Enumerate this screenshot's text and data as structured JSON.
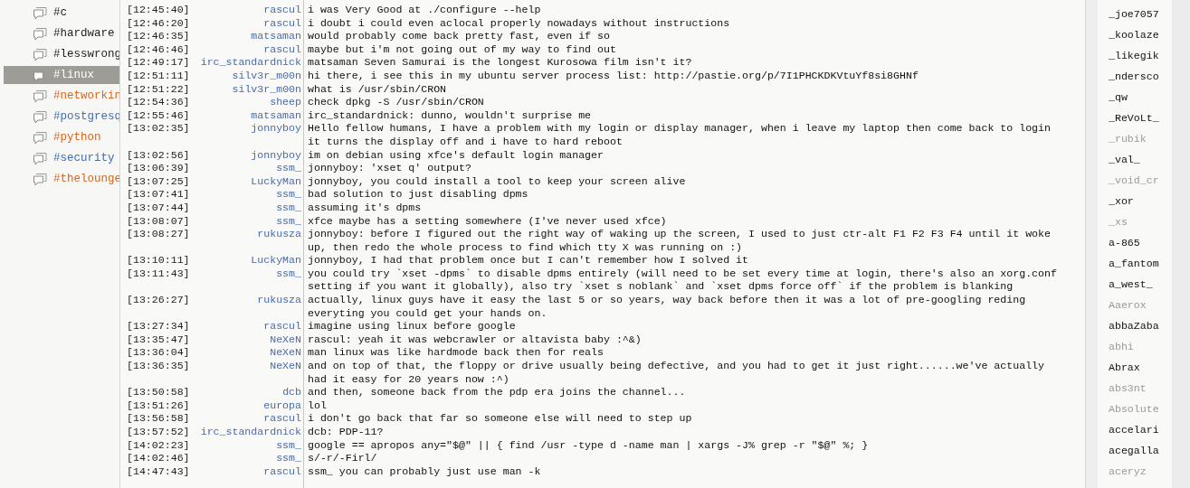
{
  "channels": [
    {
      "name": "#c",
      "selected": false
    },
    {
      "name": "#hardware",
      "selected": false
    },
    {
      "name": "#lesswrong",
      "selected": false
    },
    {
      "name": "#linux",
      "selected": true
    },
    {
      "name": "#networkin",
      "selected": false,
      "color": "#d9651c"
    },
    {
      "name": "#postgresq",
      "selected": false,
      "color": "#3d6cb8"
    },
    {
      "name": "#python",
      "selected": false,
      "color": "#d9651c"
    },
    {
      "name": "#security",
      "selected": false,
      "color": "#3d6cb8"
    },
    {
      "name": "#thelounge",
      "selected": false,
      "color": "#d9651c"
    }
  ],
  "messages": [
    {
      "time": "[12:45:40]",
      "nick": "rascul",
      "lines": [
        "i was Very Good at ./configure --help"
      ]
    },
    {
      "time": "[12:46:20]",
      "nick": "rascul",
      "lines": [
        "i doubt i could even aclocal properly nowadays without instructions"
      ]
    },
    {
      "time": "[12:46:35]",
      "nick": "matsaman",
      "lines": [
        "would probably come back pretty fast, even if so"
      ]
    },
    {
      "time": "[12:46:46]",
      "nick": "rascul",
      "lines": [
        "maybe but i'm not going out of my way to find out"
      ]
    },
    {
      "time": "[12:49:17]",
      "nick": "irc_standardnick",
      "lines": [
        "matsaman Seven Samurai is the longest Kurosowa film isn't it?"
      ]
    },
    {
      "time": "[12:51:11]",
      "nick": "silv3r_m00n",
      "lines": [
        "hi there, i see this in my ubuntu server process list: http://pastie.org/p/7I1PHCKDKVtuYf8si8GHNf"
      ]
    },
    {
      "time": "[12:51:22]",
      "nick": "silv3r_m00n",
      "lines": [
        "what is /usr/sbin/CRON"
      ]
    },
    {
      "time": "[12:54:36]",
      "nick": "sheep",
      "lines": [
        "check dpkg -S /usr/sbin/CRON"
      ]
    },
    {
      "time": "[12:55:46]",
      "nick": "matsaman",
      "lines": [
        "irc_standardnick: dunno, wouldn't surprise me"
      ]
    },
    {
      "time": "[13:02:35]",
      "nick": "jonnyboy",
      "lines": [
        "Hello fellow humans, I have a problem with my login or display manager, when i leave my laptop then come back to login",
        "it turns the display off and i have to hard reboot"
      ]
    },
    {
      "time": "[13:02:56]",
      "nick": "jonnyboy",
      "lines": [
        "im on debian using xfce's default login manager"
      ]
    },
    {
      "time": "[13:06:39]",
      "nick": "ssm_",
      "lines": [
        "jonnyboy: 'xset q' output?"
      ]
    },
    {
      "time": "[13:07:25]",
      "nick": "LuckyMan",
      "lines": [
        "jonnyboy, you could install a tool to keep your screen alive"
      ]
    },
    {
      "time": "[13:07:41]",
      "nick": "ssm_",
      "lines": [
        "bad solution to just disabling dpms"
      ]
    },
    {
      "time": "[13:07:44]",
      "nick": "ssm_",
      "lines": [
        "assuming it's dpms"
      ]
    },
    {
      "time": "[13:08:07]",
      "nick": "ssm_",
      "lines": [
        "xfce maybe has a setting somewhere (I've never used xfce)"
      ]
    },
    {
      "time": "[13:08:27]",
      "nick": "rukusza",
      "lines": [
        "jonnyboy: before I figured out the right way of waking up the screen, I used to just ctr-alt F1 F2 F3 F4 until it woke",
        "up, then redo the whole process to find which tty X was running on :)"
      ]
    },
    {
      "time": "[13:10:11]",
      "nick": "LuckyMan",
      "lines": [
        "jonnyboy, I had that problem once but I can't remember how I solved it"
      ]
    },
    {
      "time": "[13:11:43]",
      "nick": "ssm_",
      "lines": [
        "you could try `xset -dpms` to disable dpms entirely (will need to be set every time at login, there's also an xorg.conf",
        "setting if you want it globally), also try `xset s noblank` and `xset dpms force off` if the problem is blanking"
      ]
    },
    {
      "time": "[13:26:27]",
      "nick": "rukusza",
      "lines": [
        "actually, linux guys have it easy the last 5 or so years, way back before then it was a lot of pre-googling reding",
        "everyting you could get your hands on."
      ]
    },
    {
      "time": "[13:27:34]",
      "nick": "rascul",
      "lines": [
        "imagine using linux before google"
      ]
    },
    {
      "time": "[13:35:47]",
      "nick": "NeXeN",
      "lines": [
        "rascul: yeah it was webcrawler or altavista baby :^&)"
      ]
    },
    {
      "time": "[13:36:04]",
      "nick": "NeXeN",
      "lines": [
        "man linux was like hardmode back then for reals"
      ]
    },
    {
      "time": "[13:36:35]",
      "nick": "NeXeN",
      "lines": [
        "and on top of that, the floppy or drive usually being defective, and you had to get it just right......we've actually",
        "had it easy for 20 years now :^)"
      ]
    },
    {
      "time": "[13:50:58]",
      "nick": "dcb",
      "lines": [
        "and then, someone back from the pdp era joins the channel..."
      ]
    },
    {
      "time": "[13:51:26]",
      "nick": "europa",
      "lines": [
        "lol"
      ]
    },
    {
      "time": "[13:56:58]",
      "nick": "rascul",
      "lines": [
        "i don't go back that far so someone else will need to step up"
      ]
    },
    {
      "time": "[13:57:52]",
      "nick": "irc_standardnick",
      "lines": [
        "dcb: PDP-11?"
      ]
    },
    {
      "time": "[14:02:23]",
      "nick": "ssm_",
      "lines": [
        "google == apropos any=\"$@\" || { find /usr -type d -name man | xargs -J% grep -r \"$@\" %; }"
      ]
    },
    {
      "time": "[14:02:46]",
      "nick": "ssm_",
      "lines": [
        "s/-r/-Firl/"
      ]
    },
    {
      "time": "[14:47:43]",
      "nick": "rascul",
      "lines": [
        "ssm_ you can probably just use man -k"
      ]
    }
  ],
  "users": [
    {
      "name": "_joe7057",
      "away": false
    },
    {
      "name": "_koolaze",
      "away": false
    },
    {
      "name": "_likegik",
      "away": false
    },
    {
      "name": "_ndersco",
      "away": false
    },
    {
      "name": "_qw",
      "away": false
    },
    {
      "name": "_ReVoLt_",
      "away": false
    },
    {
      "name": "_rubik",
      "away": true
    },
    {
      "name": "_val_",
      "away": false
    },
    {
      "name": "_void_cr",
      "away": true
    },
    {
      "name": "_xor",
      "away": false
    },
    {
      "name": "_xs",
      "away": true
    },
    {
      "name": "a-865",
      "away": false
    },
    {
      "name": "a_fantom",
      "away": false
    },
    {
      "name": "a_west_",
      "away": false
    },
    {
      "name": "Aaerox",
      "away": true
    },
    {
      "name": "abbaZaba",
      "away": false
    },
    {
      "name": "abhi",
      "away": true
    },
    {
      "name": "Abrax",
      "away": false
    },
    {
      "name": "abs3nt",
      "away": true
    },
    {
      "name": "Absolute",
      "away": true
    },
    {
      "name": "accelari",
      "away": false
    },
    {
      "name": "acegalla",
      "away": false
    },
    {
      "name": "aceryz",
      "away": true
    }
  ]
}
